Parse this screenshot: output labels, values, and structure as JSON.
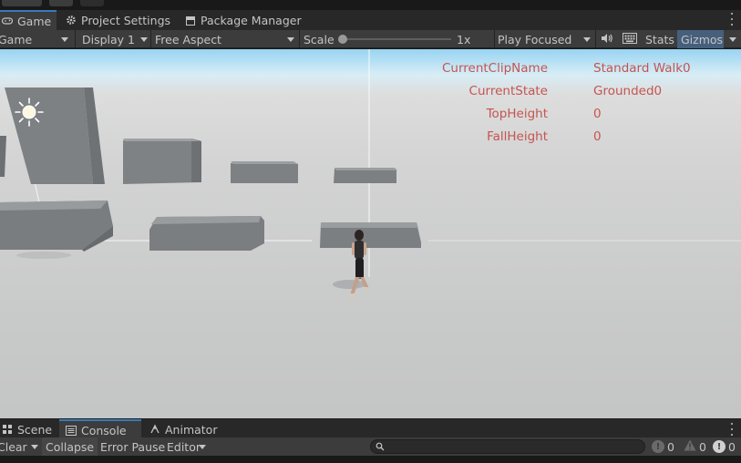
{
  "tabs": {
    "game": "Game",
    "project_settings": "Project Settings",
    "package_manager": "Package Manager"
  },
  "toolbar": {
    "mode": "Game",
    "display": "Display 1",
    "aspect": "Free Aspect",
    "scale_label": "Scale",
    "scale_value": "1x",
    "scale_level": 0.0,
    "play_mode": "Play Focused",
    "stats": "Stats",
    "gizmos": "Gizmos"
  },
  "debug": {
    "rows": [
      {
        "key": "CurrentClipName",
        "value": "Standard Walk0"
      },
      {
        "key": "CurrentState",
        "value": "Grounded0"
      },
      {
        "key": "TopHeight",
        "value": "0"
      },
      {
        "key": "FallHeight",
        "value": "0"
      }
    ],
    "text_color": "#c65450"
  },
  "bottom_tabs": {
    "scene": "Scene",
    "console": "Console",
    "animator": "Animator"
  },
  "console_toolbar": {
    "clear": "Clear",
    "collapse": "Collapse",
    "error_pause": "Error Pause",
    "editor": "Editor",
    "search_placeholder": "",
    "log_count": "0",
    "warning_count": "0",
    "error_count": "0"
  },
  "colors": {
    "accent": "#3a79bb",
    "panel": "#3c3c3c",
    "tab_bg": "#282828"
  }
}
